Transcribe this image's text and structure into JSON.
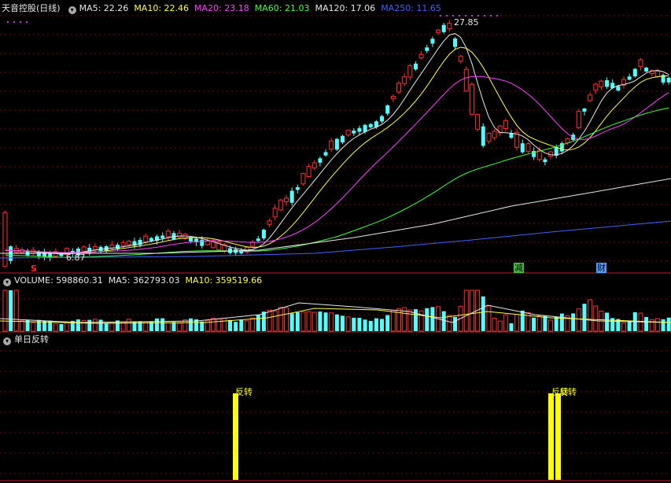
{
  "header": {
    "title": "天音控股(日线)",
    "ma": [
      {
        "label": "MA5: 22.26",
        "color": "#e8e8e8"
      },
      {
        "label": "MA10: 22.46",
        "color": "#ffff40"
      },
      {
        "label": "MA20: 23.18",
        "color": "#ff40ff"
      },
      {
        "label": "MA60: 21.03",
        "color": "#40ff40"
      },
      {
        "label": "MA120: 17.06",
        "color": "#e8e8e8"
      },
      {
        "label": "MA250: 11.65",
        "color": "#4060ff"
      }
    ]
  },
  "volume_header": {
    "items": [
      {
        "label": "VOLUME: 598860.31",
        "color": "#e8e8e8"
      },
      {
        "label": "MA5: 362793.03",
        "color": "#e8e8e8"
      },
      {
        "label": "MA10: 359519.66",
        "color": "#ffff40"
      }
    ]
  },
  "indicator_header": {
    "title": "单日反转",
    "color": "#e8e8e8"
  },
  "price_annotations": {
    "high_label": "27.85",
    "low_label": "6.87"
  },
  "markers": {
    "s_marker": "S",
    "jian": "减",
    "cai": "财"
  },
  "signals": {
    "label": "反转",
    "color": "#ffff00"
  },
  "chart_data": {
    "type": "candlestick",
    "up_color": "#ff3030",
    "down_color": "#54ffff",
    "price_range": [
      6.87,
      27.85
    ],
    "volume_up_color": "#ff3030",
    "volume_down_color": "#54ffff",
    "ma_colors": {
      "ma5": "#e8e8e8",
      "ma10": "#ffff40",
      "ma20": "#ff40ff",
      "ma60": "#40ff40",
      "ma120": "#e8e8e8",
      "ma250": "#4060ff"
    }
  }
}
